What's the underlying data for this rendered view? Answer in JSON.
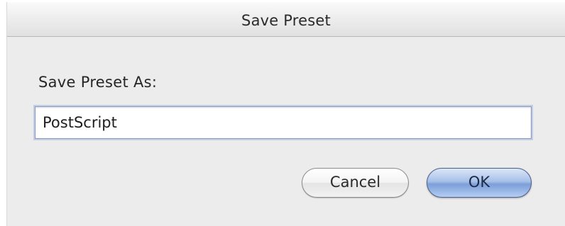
{
  "dialog": {
    "title": "Save Preset",
    "prompt_label": "Save Preset As:",
    "input_value": "PostScript",
    "cancel_label": "Cancel",
    "ok_label": "OK"
  },
  "colors": {
    "default_button": "#7c9fd9",
    "window_background": "#ececec"
  }
}
